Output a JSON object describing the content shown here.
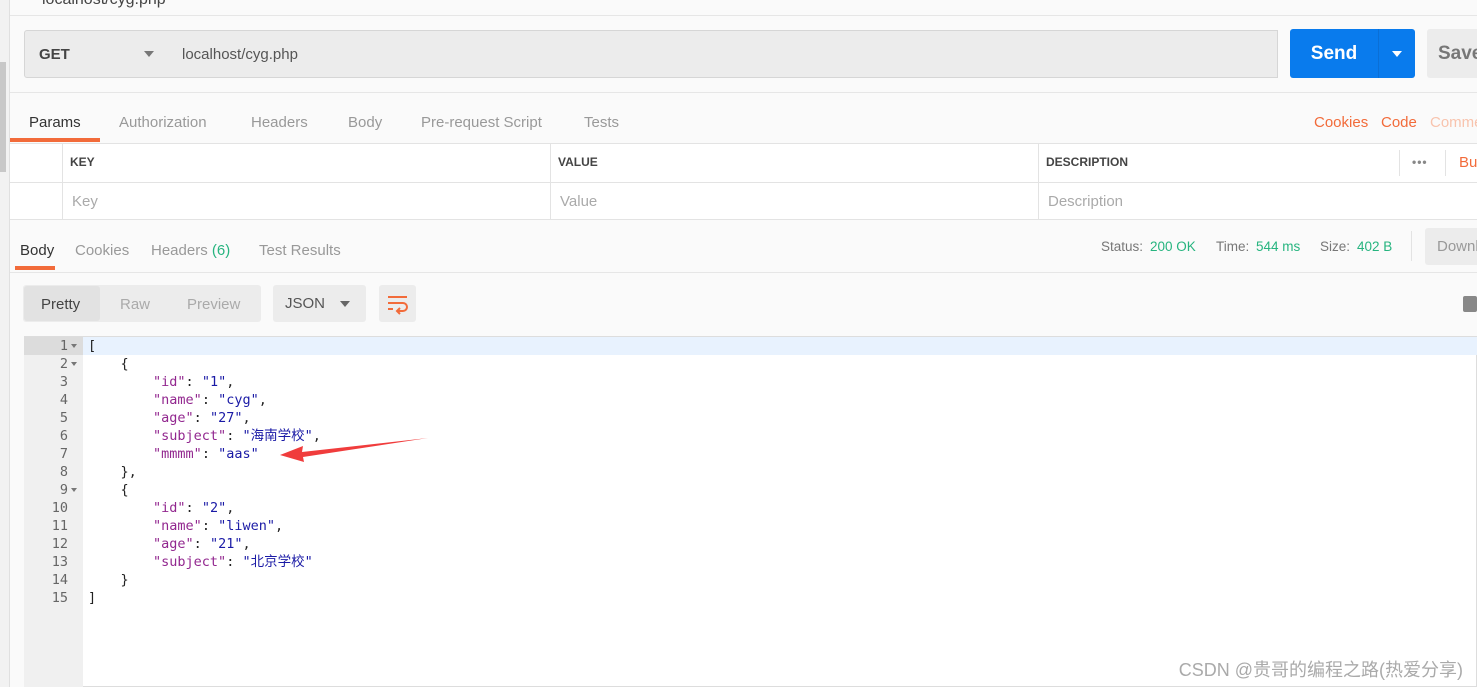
{
  "window_title": "localhost/cyg.php",
  "request": {
    "method": "GET",
    "url": "localhost/cyg.php",
    "send": "Send",
    "save": "Save"
  },
  "req_tabs": [
    "Params",
    "Authorization",
    "Headers",
    "Body",
    "Pre-request Script",
    "Tests"
  ],
  "req_links": {
    "cookies": "Cookies",
    "code": "Code",
    "comments": "Comments"
  },
  "params": {
    "headers": [
      "KEY",
      "VALUE",
      "DESCRIPTION"
    ],
    "placeholders": [
      "Key",
      "Value",
      "Description"
    ],
    "bulk": "Bulk Edit",
    "more": "•••"
  },
  "resp_tabs": [
    {
      "label": "Body"
    },
    {
      "label": "Cookies"
    },
    {
      "label": "Headers",
      "count": "(6)"
    },
    {
      "label": "Test Results"
    }
  ],
  "status": {
    "status_label": "Status:",
    "status": "200 OK",
    "time_label": "Time:",
    "time": "544 ms",
    "size_label": "Size:",
    "size": "402 B",
    "download": "Download"
  },
  "view": {
    "modes": [
      "Pretty",
      "Raw",
      "Preview"
    ],
    "format": "JSON"
  },
  "code_lines": [
    {
      "t": [
        [
          "p",
          "["
        ]
      ]
    },
    {
      "t": [
        [
          "p",
          "    {"
        ]
      ]
    },
    {
      "t": [
        [
          "p",
          "        "
        ],
        [
          "k",
          "\"id\""
        ],
        [
          "p",
          ": "
        ],
        [
          "s",
          "\"1\""
        ],
        [
          "p",
          ","
        ]
      ]
    },
    {
      "t": [
        [
          "p",
          "        "
        ],
        [
          "k",
          "\"name\""
        ],
        [
          "p",
          ": "
        ],
        [
          "s",
          "\"cyg\""
        ],
        [
          "p",
          ","
        ]
      ]
    },
    {
      "t": [
        [
          "p",
          "        "
        ],
        [
          "k",
          "\"age\""
        ],
        [
          "p",
          ": "
        ],
        [
          "s",
          "\"27\""
        ],
        [
          "p",
          ","
        ]
      ]
    },
    {
      "t": [
        [
          "p",
          "        "
        ],
        [
          "k",
          "\"subject\""
        ],
        [
          "p",
          ": "
        ],
        [
          "s",
          "\"海南学校\""
        ],
        [
          "p",
          ","
        ]
      ]
    },
    {
      "t": [
        [
          "p",
          "        "
        ],
        [
          "k",
          "\"mmmm\""
        ],
        [
          "p",
          ": "
        ],
        [
          "s",
          "\"aas\""
        ]
      ]
    },
    {
      "t": [
        [
          "p",
          "    },"
        ]
      ]
    },
    {
      "t": [
        [
          "p",
          "    {"
        ]
      ]
    },
    {
      "t": [
        [
          "p",
          "        "
        ],
        [
          "k",
          "\"id\""
        ],
        [
          "p",
          ": "
        ],
        [
          "s",
          "\"2\""
        ],
        [
          "p",
          ","
        ]
      ]
    },
    {
      "t": [
        [
          "p",
          "        "
        ],
        [
          "k",
          "\"name\""
        ],
        [
          "p",
          ": "
        ],
        [
          "s",
          "\"liwen\""
        ],
        [
          "p",
          ","
        ]
      ]
    },
    {
      "t": [
        [
          "p",
          "        "
        ],
        [
          "k",
          "\"age\""
        ],
        [
          "p",
          ": "
        ],
        [
          "s",
          "\"21\""
        ],
        [
          "p",
          ","
        ]
      ]
    },
    {
      "t": [
        [
          "p",
          "        "
        ],
        [
          "k",
          "\"subject\""
        ],
        [
          "p",
          ": "
        ],
        [
          "s",
          "\"北京学校\""
        ]
      ]
    },
    {
      "t": [
        [
          "p",
          "    }"
        ]
      ]
    },
    {
      "t": [
        [
          "p",
          "]"
        ]
      ]
    }
  ],
  "folds": [
    1,
    2,
    9
  ],
  "watermark": "CSDN @贵哥的编程之路(热爱分享)",
  "colors": {
    "accent": "#f26b3a",
    "send": "#097bed",
    "ok": "#26b47f",
    "arrow": "#f03c3c"
  }
}
